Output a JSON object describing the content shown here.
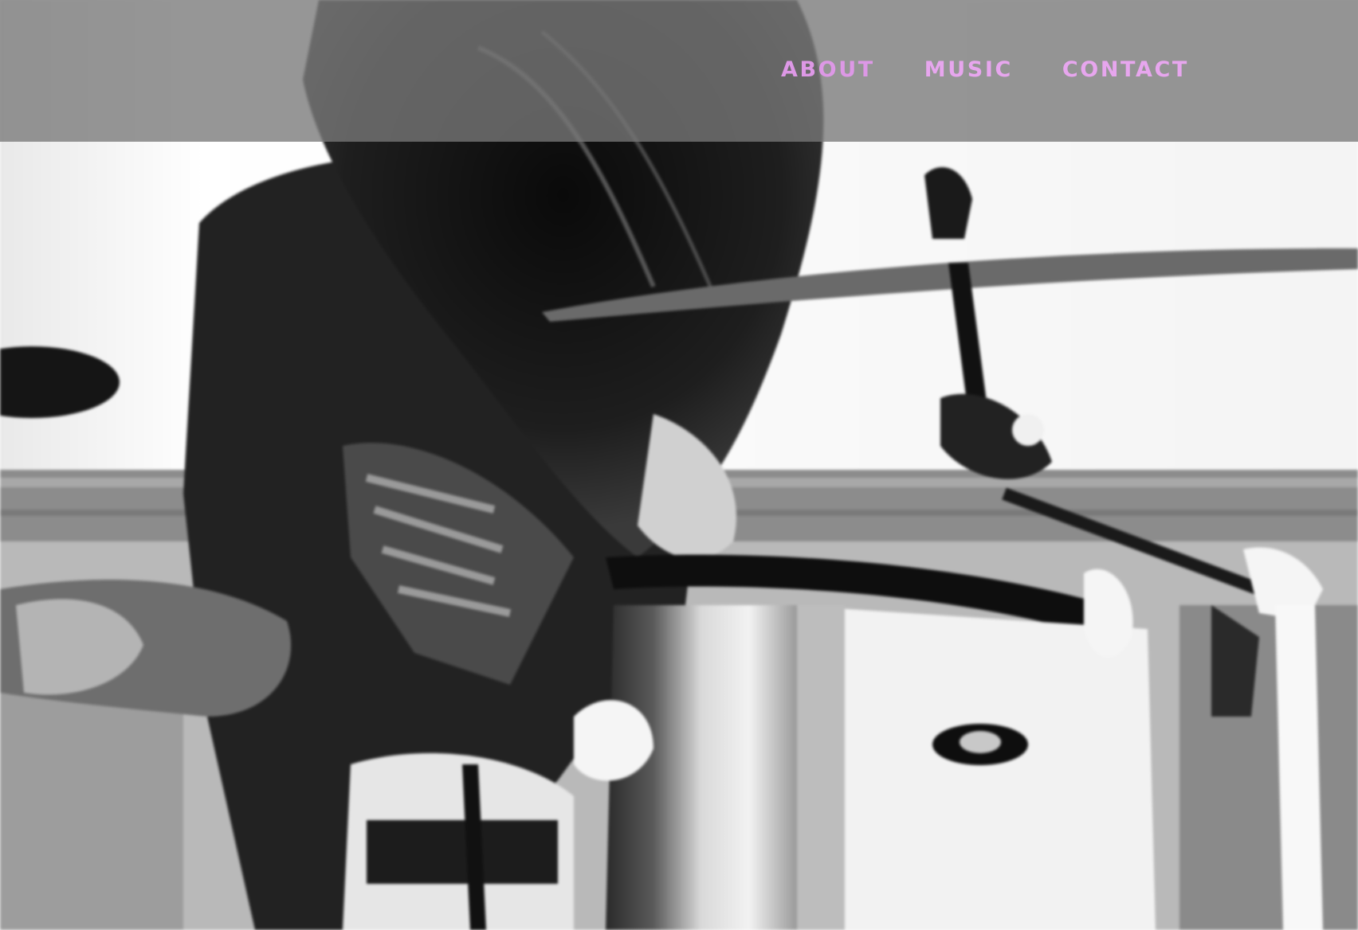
{
  "nav": {
    "items": [
      {
        "label": "ABOUT"
      },
      {
        "label": "MUSIC"
      },
      {
        "label": "CONTACT"
      }
    ]
  },
  "colors": {
    "nav_text": "#e7a6ee",
    "header_overlay": "#787878"
  },
  "hero": {
    "icon": "drummer-photo"
  }
}
